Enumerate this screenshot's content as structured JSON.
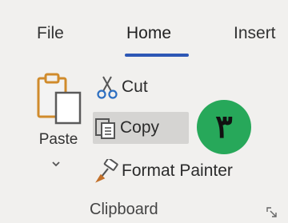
{
  "tabs": {
    "file": "File",
    "home": "Home",
    "insert": "Insert"
  },
  "clipboard": {
    "paste_label": "Paste",
    "cut_label": "Cut",
    "copy_label": "Copy",
    "format_painter_label": "Format Painter",
    "group_label": "Clipboard"
  },
  "badge": {
    "text": "۳",
    "color": "#27a85a"
  },
  "colors": {
    "accent_underline": "#2d57b5",
    "copy_highlight": "#d5d4d2",
    "background": "#f1f0ee"
  },
  "icons": {
    "paste": "clipboard-paste-icon",
    "cut": "scissors-icon",
    "copy": "copy-icon",
    "format_painter": "paintbrush-icon",
    "dropdown": "chevron-down-icon",
    "launcher": "dialog-launcher-icon"
  }
}
